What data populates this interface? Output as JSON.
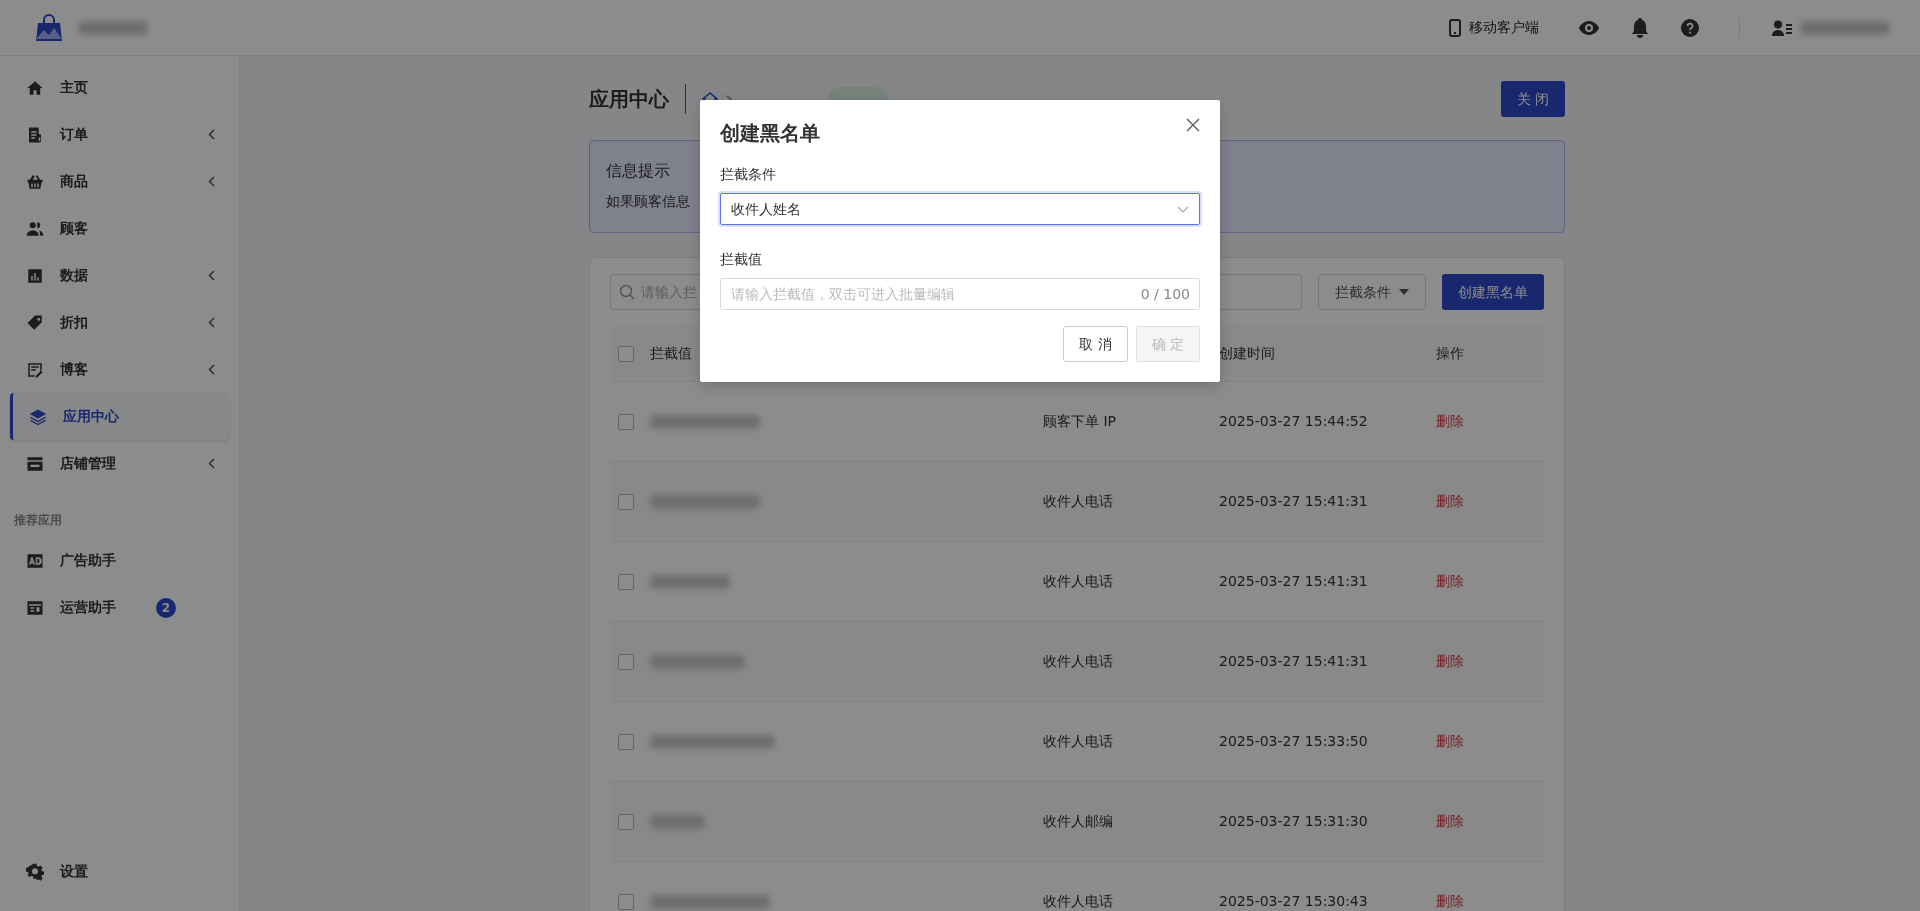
{
  "topbar": {
    "mobile_client": "移动客户端"
  },
  "sidebar": {
    "items": [
      {
        "kind": "home",
        "label": "主页",
        "expandable": false,
        "selected": false
      },
      {
        "kind": "order",
        "label": "订单",
        "expandable": true,
        "selected": false
      },
      {
        "kind": "basket",
        "label": "商品",
        "expandable": true,
        "selected": false
      },
      {
        "kind": "users",
        "label": "顾客",
        "expandable": false,
        "selected": false
      },
      {
        "kind": "chart",
        "label": "数据",
        "expandable": true,
        "selected": false
      },
      {
        "kind": "tag",
        "label": "折扣",
        "expandable": true,
        "selected": false
      },
      {
        "kind": "edit",
        "label": "博客",
        "expandable": true,
        "selected": false
      },
      {
        "kind": "layers",
        "label": "应用中心",
        "expandable": false,
        "selected": true
      },
      {
        "kind": "store",
        "label": "店铺管理",
        "expandable": true,
        "selected": false
      }
    ],
    "section_label": "推荐应用",
    "apps": [
      {
        "kind": "ad",
        "label": "广告助手"
      },
      {
        "kind": "panel",
        "label": "运营助手",
        "badge": "2"
      }
    ],
    "settings": "设置"
  },
  "page": {
    "title": "应用中心",
    "close_button": "关 闭",
    "info": {
      "title": "信息提示",
      "text": "如果顾客信息"
    },
    "toolbar": {
      "search_placeholder": "请输入拦",
      "filter": "拦截条件",
      "create_button": "创建黑名单"
    },
    "table": {
      "header_checked": false,
      "columns": [
        "拦截值",
        "创建时间",
        "操作"
      ],
      "rows": [
        {
          "checked": false,
          "condition": "顾客下单 IP",
          "created": "2025-03-27 15:44:52",
          "action": "删除"
        },
        {
          "checked": false,
          "condition": "收件人电话",
          "created": "2025-03-27 15:41:31",
          "action": "删除"
        },
        {
          "checked": false,
          "condition": "收件人电话",
          "created": "2025-03-27 15:41:31",
          "action": "删除"
        },
        {
          "checked": false,
          "condition": "收件人电话",
          "created": "2025-03-27 15:41:31",
          "action": "删除"
        },
        {
          "checked": false,
          "condition": "收件人电话",
          "created": "2025-03-27 15:33:50",
          "action": "删除"
        },
        {
          "checked": false,
          "condition": "收件人邮编",
          "created": "2025-03-27 15:31:30",
          "action": "删除"
        },
        {
          "checked": false,
          "condition": "收件人电话",
          "created": "2025-03-27 15:30:43",
          "action": "删除"
        }
      ]
    }
  },
  "modal": {
    "title": "创建黑名单",
    "condition": {
      "label": "拦截条件",
      "value": "收件人姓名",
      "focused": true
    },
    "value": {
      "label": "拦截值",
      "placeholder": "请输入拦截值，双击可进入批量编辑",
      "counter": "0 / 100"
    },
    "buttons": [
      {
        "label": "取 消",
        "disabled": false
      },
      {
        "label": "确 定",
        "disabled": true
      }
    ]
  }
}
